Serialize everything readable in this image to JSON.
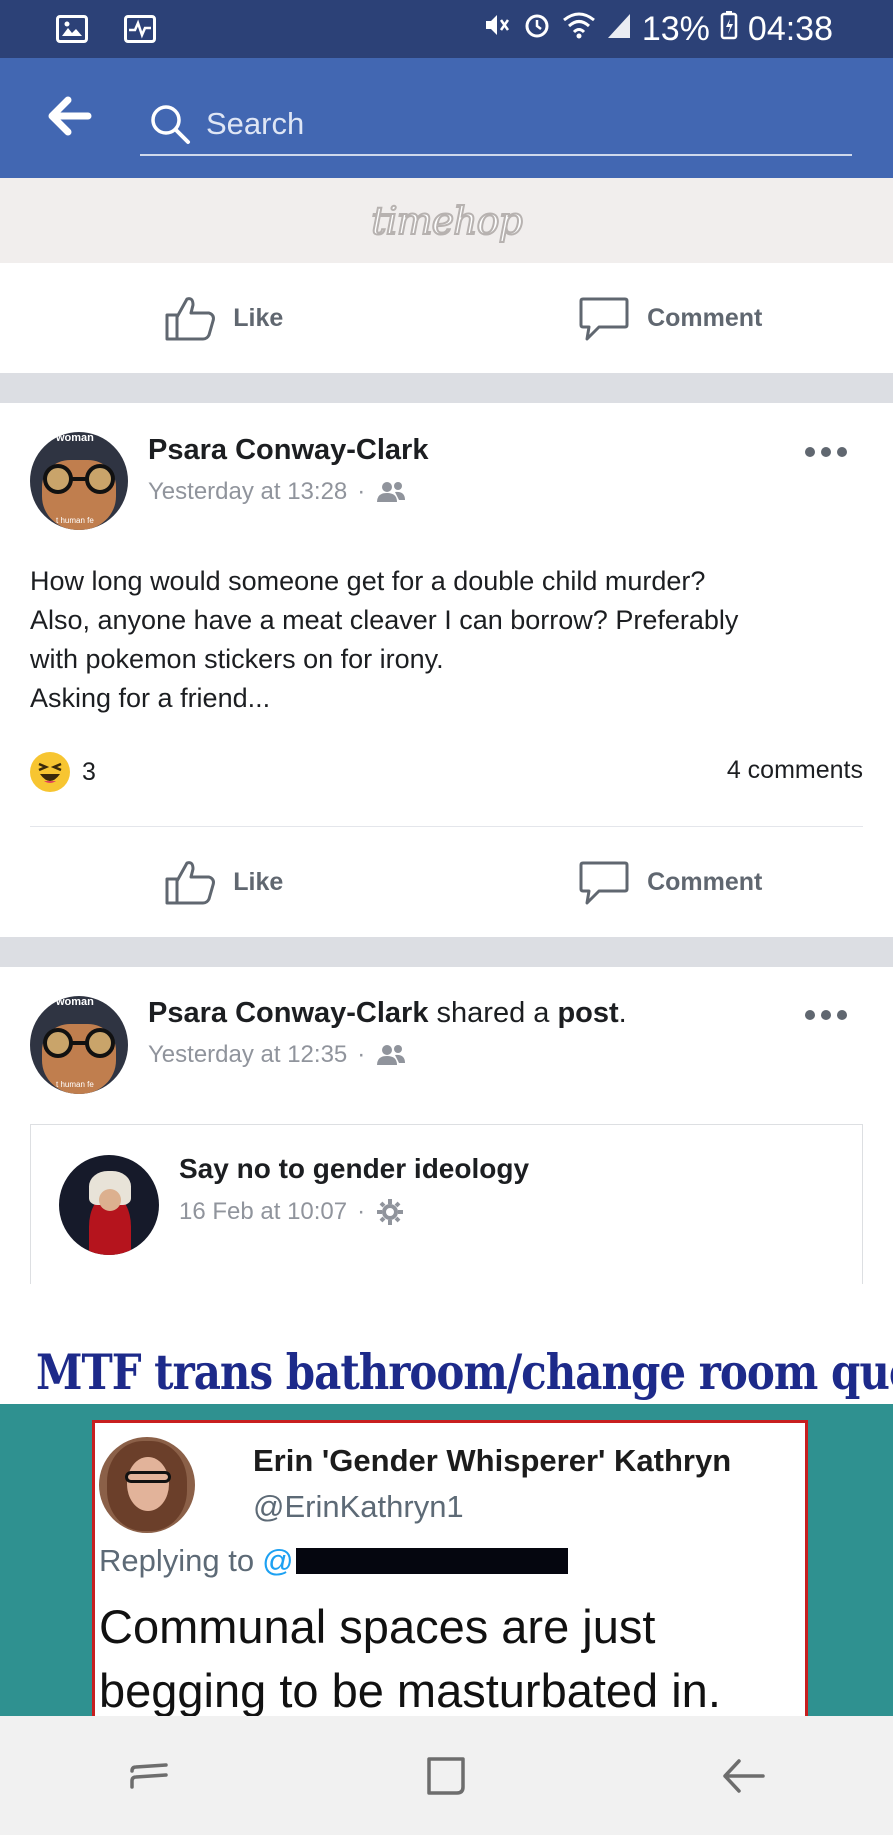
{
  "status_bar": {
    "battery": "13%",
    "time": "04:38"
  },
  "search": {
    "placeholder": "Search"
  },
  "timehop": {
    "logo_text": "timehop"
  },
  "actions": {
    "like": "Like",
    "comment": "Comment"
  },
  "post1": {
    "author": "Psara Conway-Clark",
    "timestamp": "Yesterday at 13:28",
    "separator": "·",
    "text_lines": [
      "How long would someone get for a double child murder?",
      "Also, anyone have a meat cleaver I can borrow? Preferably",
      "with pokemon stickers on for irony.",
      "Asking for a friend..."
    ],
    "reaction_count": "3",
    "comments": "4 comments"
  },
  "post2": {
    "author": "Psara Conway-Clark",
    "shared_a": "shared a",
    "post_word": "post",
    "period": ".",
    "timestamp": "Yesterday at 12:35",
    "separator": "·"
  },
  "shared": {
    "page_name": "Say no to gender ideology",
    "timestamp": "16 Feb at 10:07",
    "separator": "·"
  },
  "meme": {
    "headline": "MTF trans bathroom/change room quotes",
    "tweet_name": "Erin 'Gender Whisperer' Kathryn",
    "tweet_handle": "@ErinKathryn1",
    "replying_to": "Replying to",
    "reply_at": "@",
    "tweet_line1": "Communal spaces are just",
    "tweet_line2": "begging to be masturbated in."
  },
  "avatar_text": {
    "top": "woman",
    "bottom": "t human fe"
  },
  "colors": {
    "status_bar": "#2c4177",
    "app_bar": "#4267b2",
    "divider": "#dcdee3",
    "meme_teal": "#2f9190",
    "tweet_border": "#c81f1f",
    "headline_blue": "#1d2a8a"
  }
}
